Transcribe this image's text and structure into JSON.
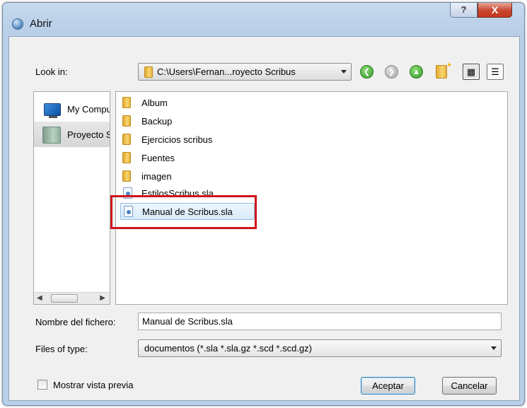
{
  "window": {
    "title": "Abrir",
    "help_glyph": "?",
    "close_glyph": "X"
  },
  "toolbar": {
    "lookin_label": "Look in:",
    "lookin_path": "C:\\Users\\Fernan...royecto Scribus",
    "back_glyph": "❮",
    "forward_glyph": "❯",
    "up_glyph": "▲",
    "icon_view_glyph": "▦",
    "detail_view_glyph": "☰"
  },
  "sidebar": {
    "items": [
      {
        "label": "My Computer"
      },
      {
        "label": "Proyecto Scribus"
      }
    ],
    "scroll_left": "◀",
    "scroll_right": "▶"
  },
  "files": [
    {
      "name": "Album",
      "kind": "folder"
    },
    {
      "name": "Backup",
      "kind": "folder"
    },
    {
      "name": "Ejercicios scribus",
      "kind": "folder"
    },
    {
      "name": "Fuentes",
      "kind": "folder"
    },
    {
      "name": "imagen",
      "kind": "folder"
    },
    {
      "name": "EstilosScribus.sla",
      "kind": "document"
    },
    {
      "name": "Manual de Scribus.sla",
      "kind": "document",
      "selected": true
    }
  ],
  "form": {
    "filename_label": "Nombre del fichero:",
    "filename_value": "Manual de Scribus.sla",
    "filetype_label": "Files of type:",
    "filetype_value": "documentos (*.sla *.sla.gz *.scd *.scd.gz)",
    "preview_label": "Mostrar vista previa",
    "preview_checked": false
  },
  "buttons": {
    "accept": "Aceptar",
    "cancel": "Cancelar"
  },
  "colors": {
    "highlight": "#d0141b",
    "frame": "#b9cfe8",
    "close": "#c9452f"
  }
}
